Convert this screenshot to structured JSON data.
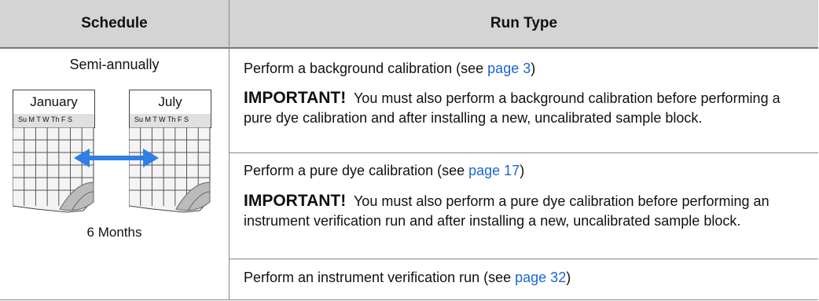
{
  "headers": {
    "schedule": "Schedule",
    "run_type": "Run Type"
  },
  "schedule": {
    "text": "Semi-annually",
    "calendar_left_month": "January",
    "calendar_right_month": "July",
    "day_labels": "Su M  T  W Th  F  S",
    "interval_caption": "6 Months"
  },
  "rows": [
    {
      "pre": "Perform a background calibration (see ",
      "link": "page 3",
      "post": ")"
    },
    {
      "important": "IMPORTANT!",
      "text": "You must also perform a background calibration before performing a pure dye calibration and after installing a new, uncalibrated sample block."
    },
    {
      "pre": "Perform a pure dye calibration (see ",
      "link": "page 17",
      "post": ")"
    },
    {
      "important": "IMPORTANT!",
      "text": "You must also perform a pure dye calibration before performing an instrument verification run and after installing a new, uncalibrated sample block."
    },
    {
      "pre": "Perform an instrument verification run (see ",
      "link": "page 32",
      "post": ")"
    }
  ],
  "colors": {
    "header_bg": "#d4d4d4",
    "link": "#1a66d6",
    "arrow": "#2e7fe6",
    "grid_line": "#555555"
  }
}
